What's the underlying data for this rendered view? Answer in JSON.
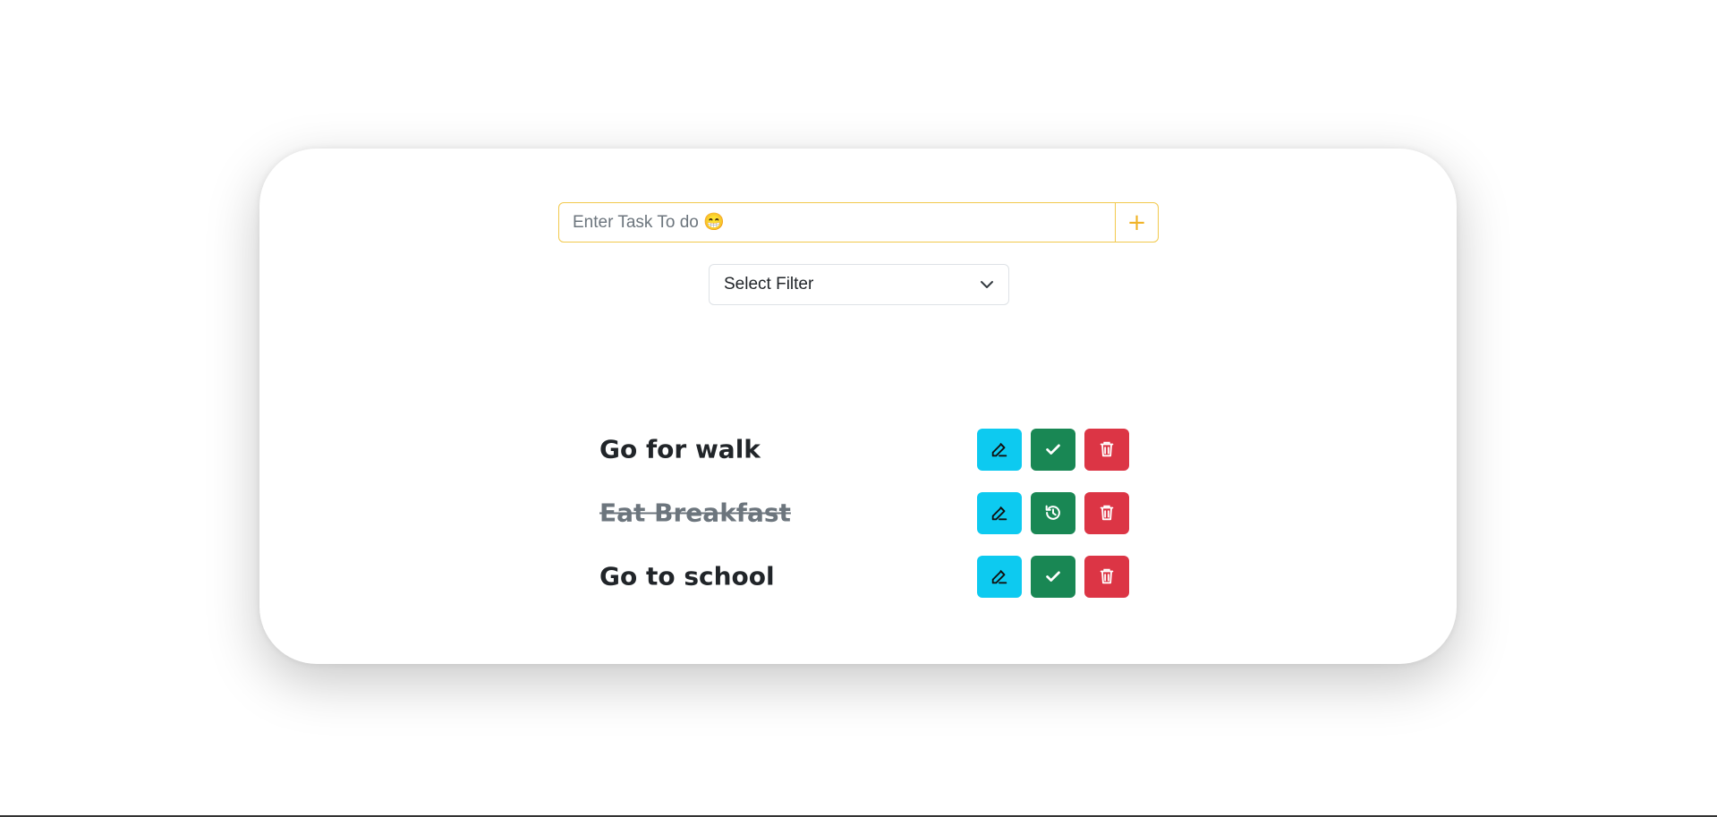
{
  "task_input": {
    "placeholder": "Enter Task To do 😁",
    "value": ""
  },
  "add_button": {
    "label": "+"
  },
  "filter": {
    "selected": "Select Filter"
  },
  "tasks": [
    {
      "text": "Go for walk",
      "completed": false,
      "status_icon": "check-icon"
    },
    {
      "text": "Eat Breakfast",
      "completed": true,
      "status_icon": "undo-history-icon"
    },
    {
      "text": "Go to school",
      "completed": false,
      "status_icon": "check-icon"
    }
  ],
  "colors": {
    "accent": "#f2c94c",
    "edit": "#0dcaf0",
    "complete": "#198754",
    "delete": "#dc3545"
  }
}
